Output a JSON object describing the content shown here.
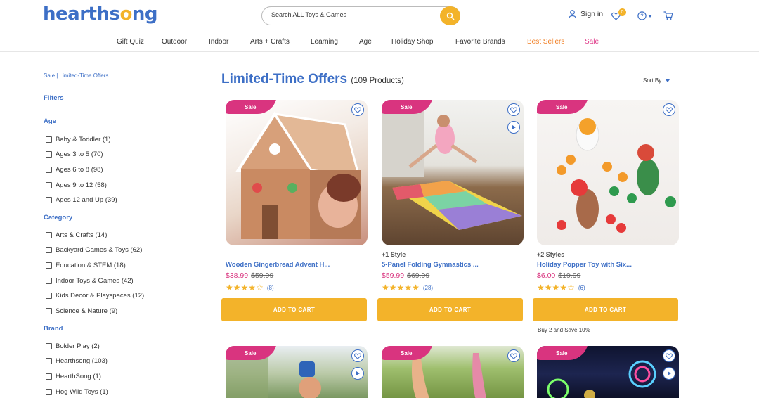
{
  "header": {
    "logo_text": "hearthsong",
    "search_placeholder": "Search ALL Toys & Games",
    "sign_in": "Sign in",
    "wishlist_count": "0"
  },
  "nav": [
    "Gift Quiz",
    "Outdoor",
    "Indoor",
    "Arts + Crafts",
    "Learning",
    "Age",
    "Holiday Shop",
    "Favorite Brands",
    "Best Sellers",
    "Sale"
  ],
  "breadcrumb": "Sale | Limited-Time Offers",
  "filters_label": "Filters",
  "sections": {
    "age": {
      "title": "Age",
      "options": [
        "Baby & Toddler (1)",
        "Ages 3 to 5 (70)",
        "Ages 6 to 8 (98)",
        "Ages 9 to 12 (58)",
        "Ages 12 and Up (39)"
      ]
    },
    "category": {
      "title": "Category",
      "options": [
        "Arts & Crafts (14)",
        "Backyard Games & Toys (62)",
        "Education & STEM (18)",
        "Indoor Toys & Games (42)",
        "Kids Decor & Playspaces (12)",
        "Science & Nature (9)"
      ]
    },
    "brand": {
      "title": "Brand",
      "options": [
        "Bolder Play (2)",
        "Hearthsong (103)",
        "HearthSong (1)",
        "Hog Wild Toys (1)"
      ]
    }
  },
  "main": {
    "title": "Limited-Time Offers",
    "count": "(109 Products)",
    "sort_label": "Sort By"
  },
  "products": [
    {
      "badge": "Sale",
      "styles": "",
      "name": "Wooden Gingerbread Advent H...",
      "price": "$38.99",
      "was": "$59.99",
      "rating": 4,
      "reviews": "(8)",
      "cta": "ADD TO CART",
      "promo": ""
    },
    {
      "badge": "Sale",
      "styles": "+1 Style",
      "name": "5-Panel Folding Gymnastics ...",
      "price": "$59.99",
      "was": "$69.99",
      "rating": 5,
      "reviews": "(28)",
      "cta": "ADD TO CART",
      "promo": ""
    },
    {
      "badge": "Sale",
      "styles": "+2 Styles",
      "name": "Holiday Popper Toy with Six...",
      "price": "$6.00",
      "was": "$19.99",
      "rating": 4,
      "reviews": "(6)",
      "cta": "ADD TO CART",
      "promo": "Buy 2 and Save 10%"
    }
  ],
  "row2_badges": [
    "Sale",
    "Sale",
    "Sale"
  ],
  "colors": {
    "brand_blue": "#3d6fc6",
    "accent_yellow": "#f3b32a",
    "sale_pink": "#d9347f",
    "best_sellers_orange": "#f07c1f"
  }
}
